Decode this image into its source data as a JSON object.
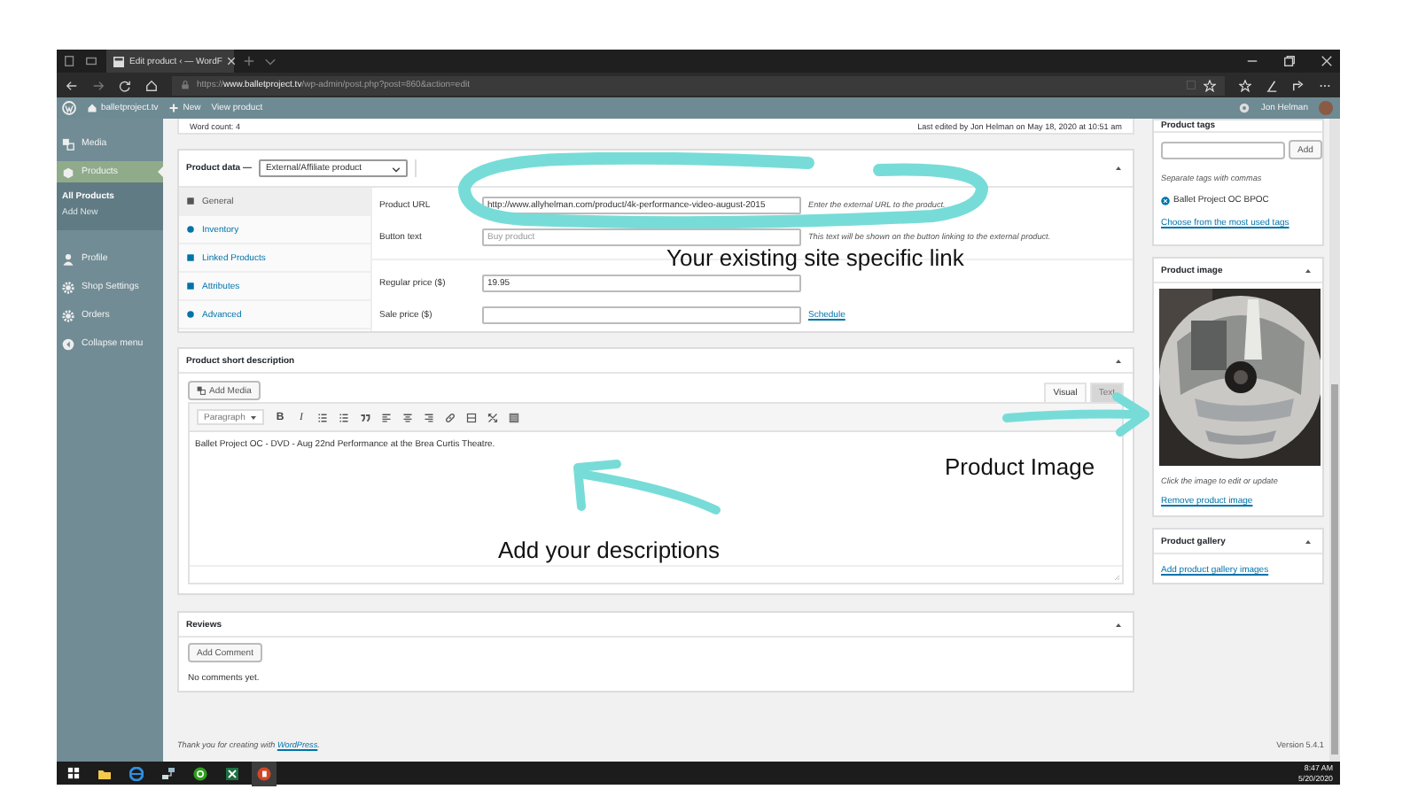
{
  "browser": {
    "tab_title": "Edit product ‹ — WordF",
    "url_scheme": "https://",
    "url_host": "www.balletproject.tv",
    "url_path": "/wp-admin/post.php?post=860&action=edit"
  },
  "admin_bar": {
    "site": "balletproject.tv",
    "new": "New",
    "view": "View product",
    "user": "Jon Helman"
  },
  "sidebar": {
    "items": [
      {
        "label": "Media",
        "selected": false
      },
      {
        "label": "Products",
        "selected": true,
        "children": [
          {
            "label": "All Products",
            "selected": true
          },
          {
            "label": "Add New",
            "selected": false
          }
        ]
      },
      {
        "label": "Profile",
        "selected": false
      },
      {
        "label": "Shop Settings",
        "selected": false
      },
      {
        "label": "Orders",
        "selected": false
      },
      {
        "label": "Collapse menu",
        "selected": false
      }
    ]
  },
  "editor_status": {
    "word_count": "Word count: 4",
    "last_edited": "Last edited by Jon Helman on May 18, 2020 at 10:51 am"
  },
  "product_data": {
    "title": "Product data —",
    "type": "External/Affiliate product",
    "tabs": [
      {
        "label": "General",
        "selected": true
      },
      {
        "label": "Inventory",
        "selected": false
      },
      {
        "label": "Linked Products",
        "selected": false
      },
      {
        "label": "Attributes",
        "selected": false
      },
      {
        "label": "Advanced",
        "selected": false
      }
    ],
    "fields": [
      {
        "label": "Product URL",
        "value": "http://www.allyhelman.com/product/4k-performance-video-august-2015",
        "hint": "Enter the external URL to the product."
      },
      {
        "label": "Button text",
        "placeholder": "Buy product",
        "hint": "This text will be shown on the button linking to the external product."
      },
      {
        "label": "Regular price ($)",
        "value": "19.95"
      },
      {
        "label": "Sale price ($)",
        "link": "Schedule"
      }
    ]
  },
  "short_description": {
    "title": "Product short description",
    "add_media": "Add Media",
    "tabs": [
      {
        "label": "Visual",
        "selected": true
      },
      {
        "label": "Text",
        "selected": false
      }
    ],
    "format": "Paragraph",
    "bold": "B",
    "italic": "I",
    "content": "Ballet Project OC - DVD - Aug 22nd Performance at the Brea Curtis Theatre."
  },
  "reviews": {
    "title": "Reviews",
    "button": "Add Comment",
    "empty": "No comments yet."
  },
  "footer": {
    "thanks": "Thank you for creating with ",
    "link": "WordPress",
    "end": ".",
    "version": "Version 5.4.1"
  },
  "product_tags": {
    "title": "Product tags",
    "add": "Add",
    "help": "Separate tags with commas",
    "tags": [
      "Ballet Project OC BPOC"
    ],
    "choose": "Choose from the most used tags"
  },
  "product_image": {
    "title": "Product image",
    "help": "Click the image to edit or update",
    "remove": "Remove product image"
  },
  "product_gallery": {
    "title": "Product gallery",
    "add": "Add product gallery images"
  },
  "taskbar": {
    "time": "8:47 AM",
    "date": "5/20/2020"
  },
  "annotations": [
    {
      "text": "Your existing site specific link"
    },
    {
      "text": "Product Image"
    },
    {
      "text": "Add your descriptions"
    }
  ]
}
